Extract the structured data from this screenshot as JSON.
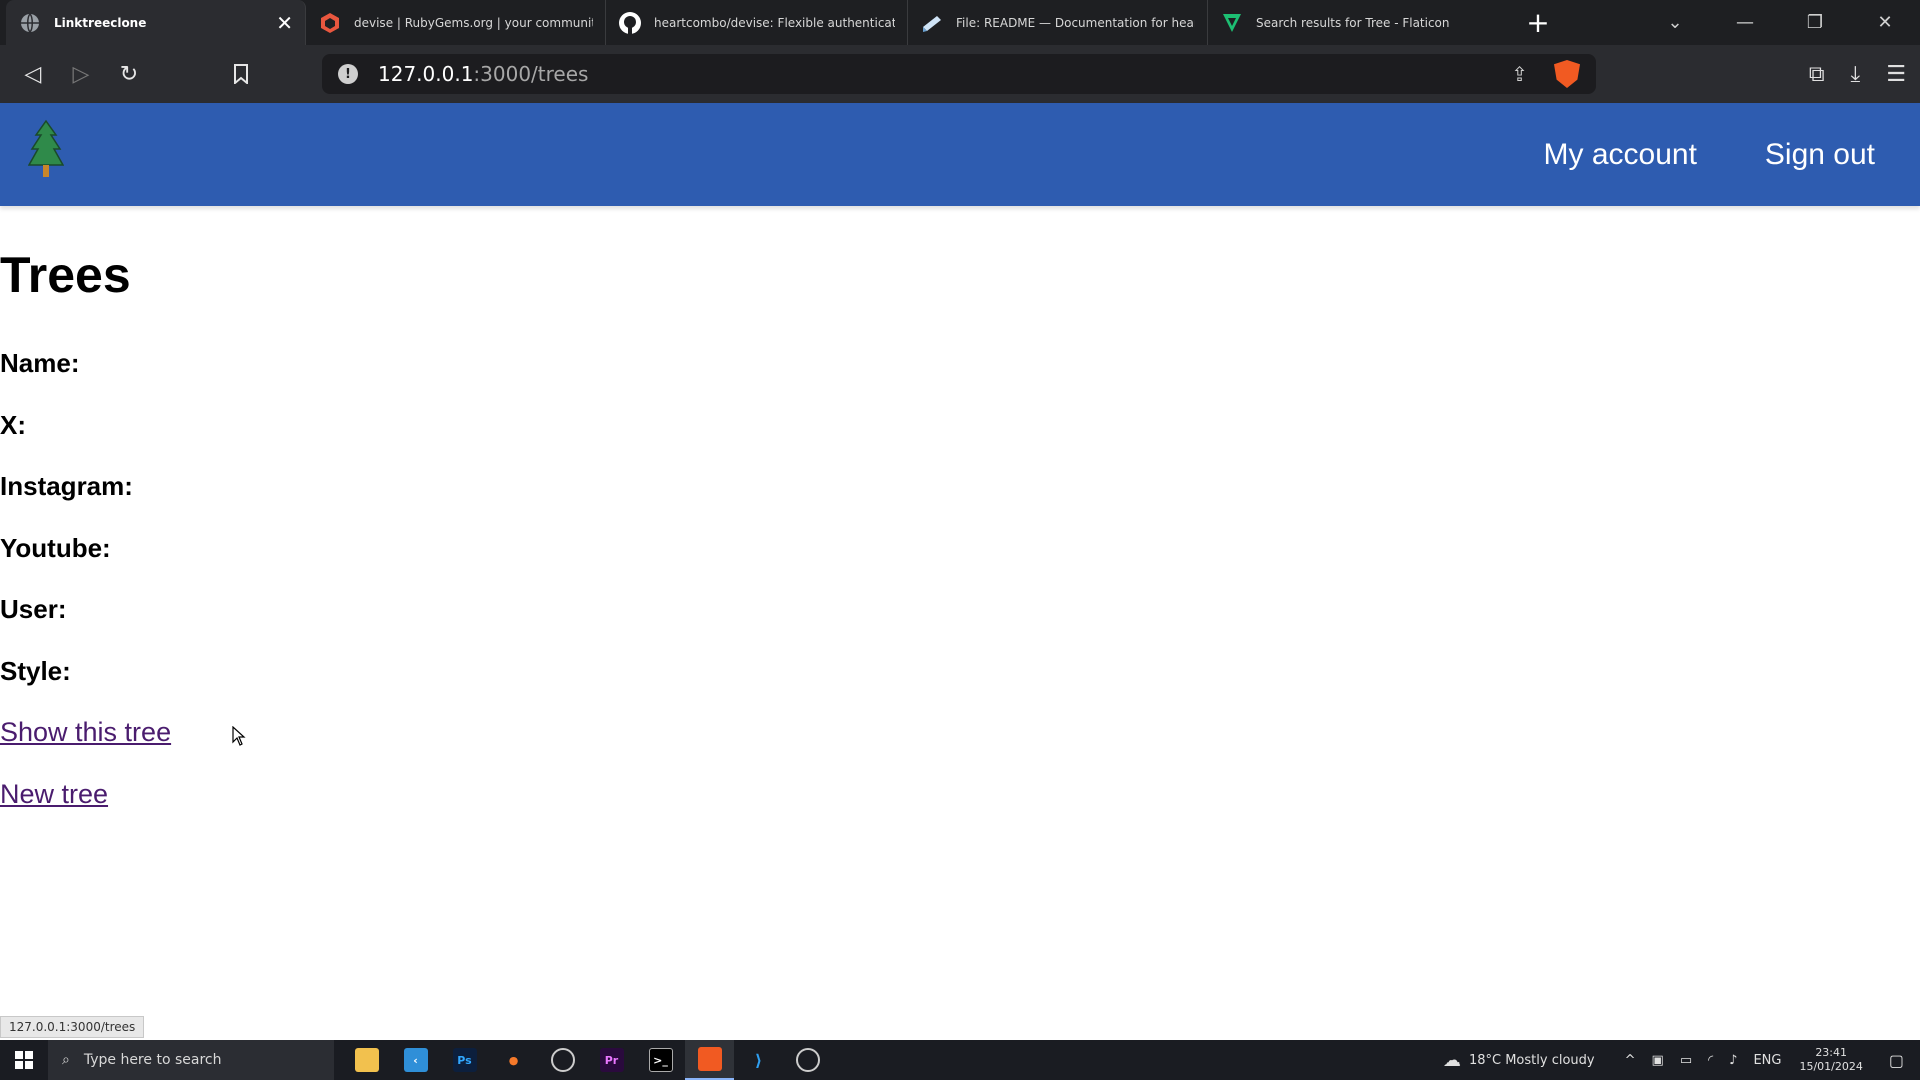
{
  "browser": {
    "tabs": [
      {
        "label": "Linktreeclone",
        "icon": "globe-icon",
        "active": true
      },
      {
        "label": "devise | RubyGems.org | your community gem",
        "icon": "rubygems-icon",
        "active": false
      },
      {
        "label": "heartcombo/devise: Flexible authentication so",
        "icon": "github-icon",
        "active": false
      },
      {
        "label": "File: README — Documentation for heartcom",
        "icon": "doc-icon",
        "active": false
      },
      {
        "label": "Search results for Tree - Flaticon",
        "icon": "flaticon-icon",
        "active": false
      }
    ],
    "url_host": "127.0.0.1",
    "url_path": ":3000/trees",
    "status_url": "127.0.0.1:3000/trees"
  },
  "app": {
    "brand_color": "#2e5cb0",
    "nav": {
      "my_account": "My account",
      "sign_out": "Sign out"
    },
    "page_title": "Trees",
    "fields": {
      "name": "Name:",
      "x": "X:",
      "instagram": "Instagram:",
      "youtube": "Youtube:",
      "user": "User:",
      "style": "Style:"
    },
    "links": {
      "show_tree": "Show this tree",
      "new_tree": "New tree"
    }
  },
  "taskbar": {
    "search_placeholder": "Type here to search",
    "weather": "18°C  Mostly cloudy",
    "language": "ENG",
    "time": "23:41",
    "date": "15/01/2024"
  }
}
